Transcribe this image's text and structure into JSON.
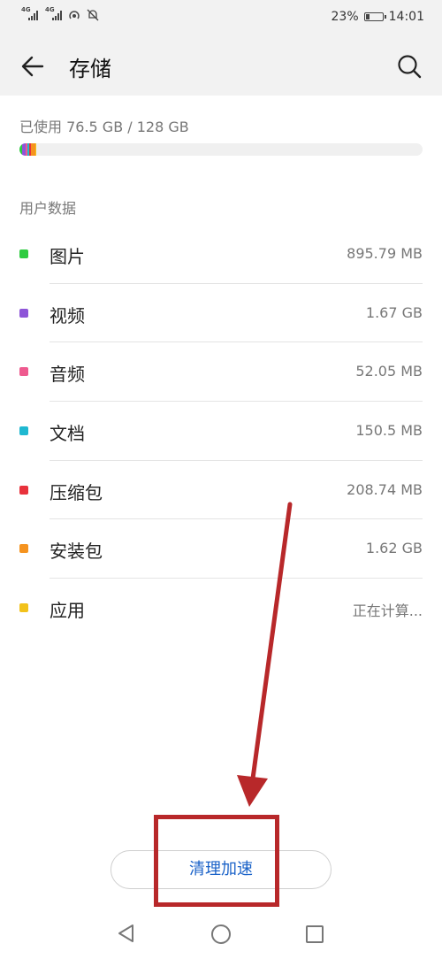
{
  "status_bar": {
    "signal_1": "4G",
    "signal_2": "4G",
    "battery_text": "23%",
    "battery_level": 0.23,
    "time": "14:01"
  },
  "header": {
    "title": "存储",
    "back_icon": "arrow-left-icon",
    "search_icon": "search-icon"
  },
  "usage": {
    "text": "已使用 76.5 GB / 128 GB",
    "segments": [
      {
        "color": "#2ecc40",
        "fraction": 0.0055
      },
      {
        "color": "#8e55d8",
        "fraction": 0.0105
      },
      {
        "color": "#ee5a8f",
        "fraction": 0.004
      },
      {
        "color": "#1fb8d1",
        "fraction": 0.004
      },
      {
        "color": "#e8323c",
        "fraction": 0.0045
      },
      {
        "color": "#f5931f",
        "fraction": 0.0105
      },
      {
        "color": "#f2c21b",
        "fraction": 0.003
      }
    ]
  },
  "section": {
    "title": "用户数据"
  },
  "items": [
    {
      "label": "图片",
      "value": "895.79 MB",
      "color": "#2ecc40"
    },
    {
      "label": "视频",
      "value": "1.67 GB",
      "color": "#8e55d8"
    },
    {
      "label": "音频",
      "value": "52.05 MB",
      "color": "#ee5a8f"
    },
    {
      "label": "文档",
      "value": "150.5 MB",
      "color": "#1fb8d1"
    },
    {
      "label": "压缩包",
      "value": "208.74 MB",
      "color": "#e8323c"
    },
    {
      "label": "安装包",
      "value": "1.62 GB",
      "color": "#f5931f"
    },
    {
      "label": "应用",
      "value": "正在计算...",
      "color": "#f2c21b"
    }
  ],
  "action": {
    "clean_label": "清理加速"
  },
  "annotation_color": "#b8282a",
  "nav": {
    "back_icon": "nav-back-icon",
    "home_icon": "nav-home-icon",
    "recent_icon": "nav-recent-icon"
  }
}
